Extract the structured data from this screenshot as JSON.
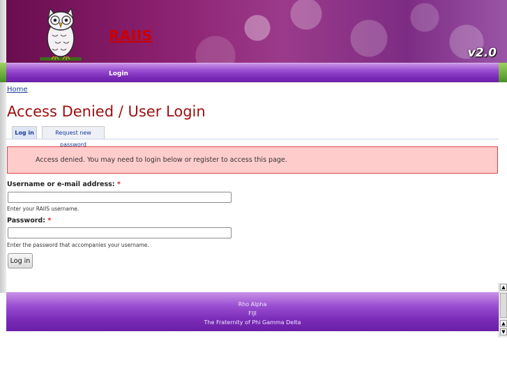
{
  "header": {
    "site_title": "RAIIS",
    "version": "v2.0"
  },
  "nav": {
    "login_label": "Login"
  },
  "breadcrumb": {
    "home_label": "Home"
  },
  "page": {
    "title": "Access Denied / User Login"
  },
  "tabs": [
    {
      "label": "Log in",
      "active": true
    },
    {
      "label": "Request new password",
      "active": false
    }
  ],
  "alert": {
    "message": "Access denied. You may need to login below or register to access this page."
  },
  "form": {
    "username_label": "Username or e-mail address:",
    "required_marker": "*",
    "username_help": "Enter your RAIIS username.",
    "password_label": "Password:",
    "password_help": "Enter the password that accompanies your username.",
    "submit_label": "Log in"
  },
  "footer": {
    "line1": "Rho Alpha",
    "line2": "FIJI",
    "line3": "The Fraternity of Phi Gamma Delta"
  },
  "colors": {
    "brand_purple": "#7a2bb8",
    "heading_red": "#9b0f0f",
    "alert_bg": "#ffcccc",
    "alert_border": "#e34040"
  },
  "icons": {
    "logo": "owl-logo-icon",
    "scroll_up": "arrow-up-icon",
    "scroll_down": "arrow-down-icon"
  }
}
